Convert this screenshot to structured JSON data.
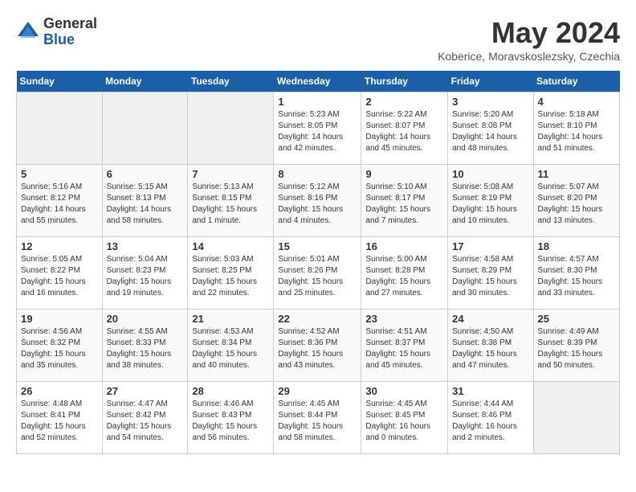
{
  "header": {
    "logo_general": "General",
    "logo_blue": "Blue",
    "month_year": "May 2024",
    "location": "Koberice, Moravskoslezsky, Czechia"
  },
  "weekdays": [
    "Sunday",
    "Monday",
    "Tuesday",
    "Wednesday",
    "Thursday",
    "Friday",
    "Saturday"
  ],
  "weeks": [
    [
      {
        "day": "",
        "info": ""
      },
      {
        "day": "",
        "info": ""
      },
      {
        "day": "",
        "info": ""
      },
      {
        "day": "1",
        "info": "Sunrise: 5:23 AM\nSunset: 8:05 PM\nDaylight: 14 hours\nand 42 minutes."
      },
      {
        "day": "2",
        "info": "Sunrise: 5:22 AM\nSunset: 8:07 PM\nDaylight: 14 hours\nand 45 minutes."
      },
      {
        "day": "3",
        "info": "Sunrise: 5:20 AM\nSunset: 8:08 PM\nDaylight: 14 hours\nand 48 minutes."
      },
      {
        "day": "4",
        "info": "Sunrise: 5:18 AM\nSunset: 8:10 PM\nDaylight: 14 hours\nand 51 minutes."
      }
    ],
    [
      {
        "day": "5",
        "info": "Sunrise: 5:16 AM\nSunset: 8:12 PM\nDaylight: 14 hours\nand 55 minutes."
      },
      {
        "day": "6",
        "info": "Sunrise: 5:15 AM\nSunset: 8:13 PM\nDaylight: 14 hours\nand 58 minutes."
      },
      {
        "day": "7",
        "info": "Sunrise: 5:13 AM\nSunset: 8:15 PM\nDaylight: 15 hours\nand 1 minute."
      },
      {
        "day": "8",
        "info": "Sunrise: 5:12 AM\nSunset: 8:16 PM\nDaylight: 15 hours\nand 4 minutes."
      },
      {
        "day": "9",
        "info": "Sunrise: 5:10 AM\nSunset: 8:17 PM\nDaylight: 15 hours\nand 7 minutes."
      },
      {
        "day": "10",
        "info": "Sunrise: 5:08 AM\nSunset: 8:19 PM\nDaylight: 15 hours\nand 10 minutes."
      },
      {
        "day": "11",
        "info": "Sunrise: 5:07 AM\nSunset: 8:20 PM\nDaylight: 15 hours\nand 13 minutes."
      }
    ],
    [
      {
        "day": "12",
        "info": "Sunrise: 5:05 AM\nSunset: 8:22 PM\nDaylight: 15 hours\nand 16 minutes."
      },
      {
        "day": "13",
        "info": "Sunrise: 5:04 AM\nSunset: 8:23 PM\nDaylight: 15 hours\nand 19 minutes."
      },
      {
        "day": "14",
        "info": "Sunrise: 5:03 AM\nSunset: 8:25 PM\nDaylight: 15 hours\nand 22 minutes."
      },
      {
        "day": "15",
        "info": "Sunrise: 5:01 AM\nSunset: 8:26 PM\nDaylight: 15 hours\nand 25 minutes."
      },
      {
        "day": "16",
        "info": "Sunrise: 5:00 AM\nSunset: 8:28 PM\nDaylight: 15 hours\nand 27 minutes."
      },
      {
        "day": "17",
        "info": "Sunrise: 4:58 AM\nSunset: 8:29 PM\nDaylight: 15 hours\nand 30 minutes."
      },
      {
        "day": "18",
        "info": "Sunrise: 4:57 AM\nSunset: 8:30 PM\nDaylight: 15 hours\nand 33 minutes."
      }
    ],
    [
      {
        "day": "19",
        "info": "Sunrise: 4:56 AM\nSunset: 8:32 PM\nDaylight: 15 hours\nand 35 minutes."
      },
      {
        "day": "20",
        "info": "Sunrise: 4:55 AM\nSunset: 8:33 PM\nDaylight: 15 hours\nand 38 minutes."
      },
      {
        "day": "21",
        "info": "Sunrise: 4:53 AM\nSunset: 8:34 PM\nDaylight: 15 hours\nand 40 minutes."
      },
      {
        "day": "22",
        "info": "Sunrise: 4:52 AM\nSunset: 8:36 PM\nDaylight: 15 hours\nand 43 minutes."
      },
      {
        "day": "23",
        "info": "Sunrise: 4:51 AM\nSunset: 8:37 PM\nDaylight: 15 hours\nand 45 minutes."
      },
      {
        "day": "24",
        "info": "Sunrise: 4:50 AM\nSunset: 8:38 PM\nDaylight: 15 hours\nand 47 minutes."
      },
      {
        "day": "25",
        "info": "Sunrise: 4:49 AM\nSunset: 8:39 PM\nDaylight: 15 hours\nand 50 minutes."
      }
    ],
    [
      {
        "day": "26",
        "info": "Sunrise: 4:48 AM\nSunset: 8:41 PM\nDaylight: 15 hours\nand 52 minutes."
      },
      {
        "day": "27",
        "info": "Sunrise: 4:47 AM\nSunset: 8:42 PM\nDaylight: 15 hours\nand 54 minutes."
      },
      {
        "day": "28",
        "info": "Sunrise: 4:46 AM\nSunset: 8:43 PM\nDaylight: 15 hours\nand 56 minutes."
      },
      {
        "day": "29",
        "info": "Sunrise: 4:45 AM\nSunset: 8:44 PM\nDaylight: 15 hours\nand 58 minutes."
      },
      {
        "day": "30",
        "info": "Sunrise: 4:45 AM\nSunset: 8:45 PM\nDaylight: 16 hours\nand 0 minutes."
      },
      {
        "day": "31",
        "info": "Sunrise: 4:44 AM\nSunset: 8:46 PM\nDaylight: 16 hours\nand 2 minutes."
      },
      {
        "day": "",
        "info": ""
      }
    ]
  ]
}
